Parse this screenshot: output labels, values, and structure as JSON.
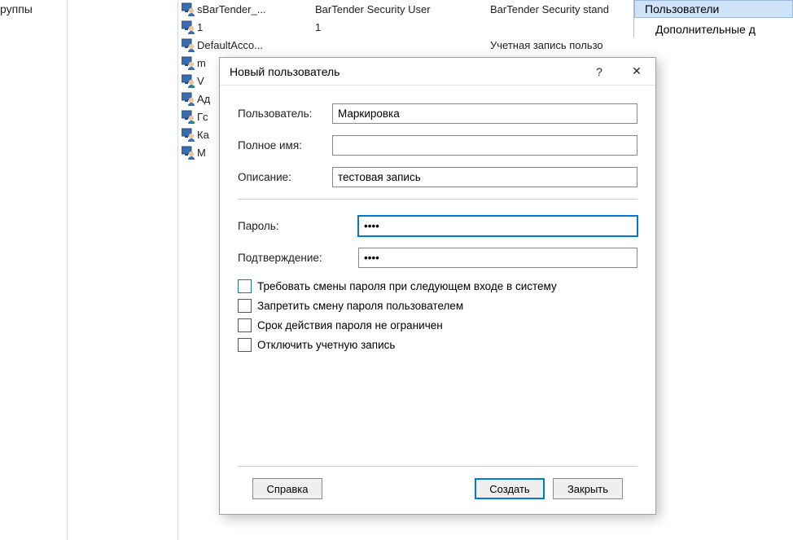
{
  "bg": {
    "left_label": "руппы",
    "right_panel": {
      "highlight": "Пользователи",
      "line2": "Дополнительные д"
    },
    "rows": [
      {
        "c1": "sBarTender_...",
        "c2": "BarTender Security User",
        "c3": "BarTender Security stand"
      },
      {
        "c1": "1",
        "c2": "1",
        "c3": ""
      },
      {
        "c1": "DefaultAcco...",
        "c2": "",
        "c3": "Учетная запись пользо"
      },
      {
        "c1": "m",
        "c2": "",
        "c3": ""
      },
      {
        "c1": "V",
        "c2": "",
        "c3": ""
      },
      {
        "c1": "Ад",
        "c2": "",
        "c3": ""
      },
      {
        "c1": "Гс",
        "c2": "",
        "c3": ""
      },
      {
        "c1": "Ка",
        "c2": "",
        "c3": ""
      },
      {
        "c1": "М",
        "c2": "",
        "c3": ""
      }
    ]
  },
  "dialog": {
    "title": "Новый пользователь",
    "help_char": "?",
    "close_char": "✕",
    "fields": {
      "user_label": "Пользователь:",
      "user_value": "Маркировка",
      "fullname_label": "Полное имя:",
      "fullname_value": "",
      "desc_label": "Описание:",
      "desc_value": "тестовая запись",
      "pwd_label": "Пароль:",
      "pwd_value": "••••",
      "pwd2_label": "Подтверждение:",
      "pwd2_value": "••••"
    },
    "checks": {
      "c1": "Требовать смены пароля при следующем входе в систему",
      "c2": "Запретить смену пароля пользователем",
      "c3": "Срок действия пароля не ограничен",
      "c4": "Отключить учетную запись"
    },
    "buttons": {
      "help": "Справка",
      "create": "Создать",
      "close": "Закрыть"
    }
  }
}
